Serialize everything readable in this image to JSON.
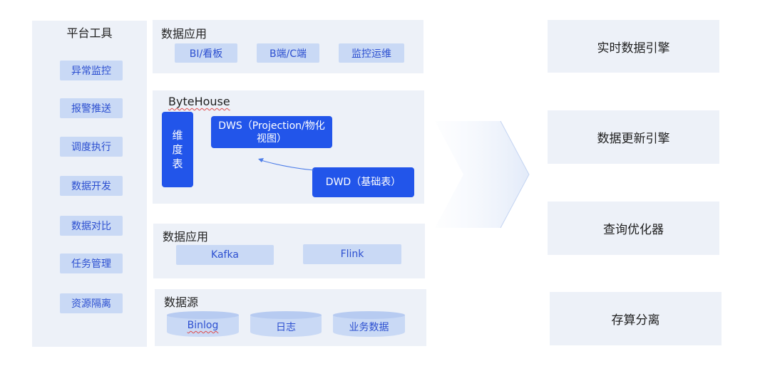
{
  "platform": {
    "title": "平台工具",
    "items": [
      "异常监控",
      "报警推送",
      "调度执行",
      "数据开发",
      "数据对比",
      "任务管理",
      "资源隔离"
    ]
  },
  "app_top": {
    "title": "数据应用",
    "items": [
      "BI/看板",
      "B端/C端",
      "监控运维"
    ]
  },
  "bytehouse": {
    "title": "ByteHouse",
    "dim": "维度表",
    "dws": "DWS（Projection/物化视图）",
    "dwd": "DWD（基础表）"
  },
  "app_mid": {
    "title": "数据应用",
    "items": [
      "Kafka",
      "Flink"
    ]
  },
  "source": {
    "title": "数据源",
    "items": [
      "Binlog",
      "日志",
      "业务数据"
    ]
  },
  "engines": [
    "实时数据引擎",
    "数据更新引擎",
    "查询优化器",
    "存算分离"
  ],
  "colors": {
    "accent": "#2255ea",
    "chip": "#c9d9f5",
    "panel": "#edf1f8"
  }
}
